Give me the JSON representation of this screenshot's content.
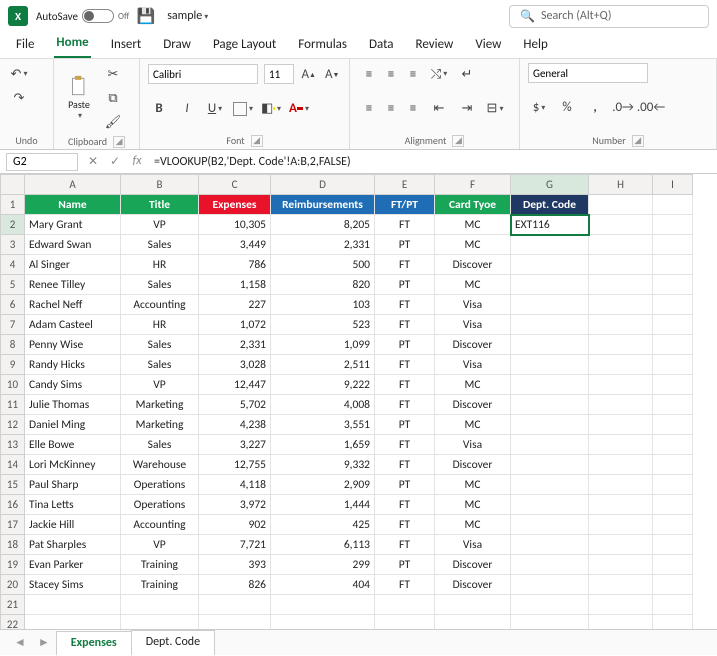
{
  "titlebar": {
    "autosave_label": "AutoSave",
    "autosave_state": "Off",
    "doc_name": "sample",
    "search_placeholder": "Search (Alt+Q)"
  },
  "tabs": {
    "file": "File",
    "home": "Home",
    "insert": "Insert",
    "draw": "Draw",
    "page_layout": "Page Layout",
    "formulas": "Formulas",
    "data": "Data",
    "review": "Review",
    "view": "View",
    "help": "Help",
    "active": "Home"
  },
  "ribbon": {
    "undo_group": "Undo",
    "clipboard_group": "Clipboard",
    "paste_label": "Paste",
    "font_group": "Font",
    "font_name": "Calibri",
    "font_size": "11",
    "alignment_group": "Alignment",
    "number_group": "Number",
    "number_format": "General"
  },
  "formula_bar": {
    "namebox": "G2",
    "formula": "=VLOOKUP(B2,'Dept. Code'!A:B,2,FALSE)"
  },
  "columns": [
    "A",
    "B",
    "C",
    "D",
    "E",
    "F",
    "G",
    "H",
    "I"
  ],
  "headers": {
    "A": "Name",
    "B": "Title",
    "C": "Expenses",
    "D": "Reimbursements",
    "E": "FT/PT",
    "F": "Card Tyoe",
    "G": "Dept. Code"
  },
  "rows": [
    {
      "n": 2,
      "A": "Mary Grant",
      "B": "VP",
      "C": "10,305",
      "D": "8,205",
      "E": "FT",
      "F": "MC",
      "G": "EXT116"
    },
    {
      "n": 3,
      "A": "Edward Swan",
      "B": "Sales",
      "C": "3,449",
      "D": "2,331",
      "E": "PT",
      "F": "MC",
      "G": ""
    },
    {
      "n": 4,
      "A": "Al Singer",
      "B": "HR",
      "C": "786",
      "D": "500",
      "E": "FT",
      "F": "Discover",
      "G": ""
    },
    {
      "n": 5,
      "A": "Renee Tilley",
      "B": "Sales",
      "C": "1,158",
      "D": "820",
      "E": "PT",
      "F": "MC",
      "G": ""
    },
    {
      "n": 6,
      "A": "Rachel Neff",
      "B": "Accounting",
      "C": "227",
      "D": "103",
      "E": "FT",
      "F": "Visa",
      "G": ""
    },
    {
      "n": 7,
      "A": "Adam Casteel",
      "B": "HR",
      "C": "1,072",
      "D": "523",
      "E": "FT",
      "F": "Visa",
      "G": ""
    },
    {
      "n": 8,
      "A": "Penny Wise",
      "B": "Sales",
      "C": "2,331",
      "D": "1,099",
      "E": "PT",
      "F": "Discover",
      "G": ""
    },
    {
      "n": 9,
      "A": "Randy Hicks",
      "B": "Sales",
      "C": "3,028",
      "D": "2,511",
      "E": "FT",
      "F": "Visa",
      "G": ""
    },
    {
      "n": 10,
      "A": "Candy Sims",
      "B": "VP",
      "C": "12,447",
      "D": "9,222",
      "E": "FT",
      "F": "MC",
      "G": ""
    },
    {
      "n": 11,
      "A": "Julie Thomas",
      "B": "Marketing",
      "C": "5,702",
      "D": "4,008",
      "E": "FT",
      "F": "Discover",
      "G": ""
    },
    {
      "n": 12,
      "A": "Daniel Ming",
      "B": "Marketing",
      "C": "4,238",
      "D": "3,551",
      "E": "PT",
      "F": "MC",
      "G": ""
    },
    {
      "n": 13,
      "A": "Elle Bowe",
      "B": "Sales",
      "C": "3,227",
      "D": "1,659",
      "E": "FT",
      "F": "Visa",
      "G": ""
    },
    {
      "n": 14,
      "A": "Lori McKinney",
      "B": "Warehouse",
      "C": "12,755",
      "D": "9,332",
      "E": "FT",
      "F": "Discover",
      "G": ""
    },
    {
      "n": 15,
      "A": "Paul Sharp",
      "B": "Operations",
      "C": "4,118",
      "D": "2,909",
      "E": "PT",
      "F": "MC",
      "G": ""
    },
    {
      "n": 16,
      "A": "Tina Letts",
      "B": "Operations",
      "C": "3,972",
      "D": "1,444",
      "E": "FT",
      "F": "MC",
      "G": ""
    },
    {
      "n": 17,
      "A": "Jackie Hill",
      "B": "Accounting",
      "C": "902",
      "D": "425",
      "E": "FT",
      "F": "MC",
      "G": ""
    },
    {
      "n": 18,
      "A": "Pat Sharples",
      "B": "VP",
      "C": "7,721",
      "D": "6,113",
      "E": "FT",
      "F": "Visa",
      "G": ""
    },
    {
      "n": 19,
      "A": "Evan Parker",
      "B": "Training",
      "C": "393",
      "D": "299",
      "E": "PT",
      "F": "Discover",
      "G": ""
    },
    {
      "n": 20,
      "A": "Stacey Sims",
      "B": "Training",
      "C": "826",
      "D": "404",
      "E": "FT",
      "F": "Discover",
      "G": ""
    }
  ],
  "blank_rows": [
    21,
    22
  ],
  "sheets": {
    "active": "Expenses",
    "list": [
      "Expenses",
      "Dept. Code"
    ]
  },
  "selected_cell": "G2",
  "colors": {
    "green": "#18a558",
    "red": "#e8132b",
    "blue": "#1f6db5",
    "navy": "#1f3864",
    "accent": "#107c41"
  }
}
